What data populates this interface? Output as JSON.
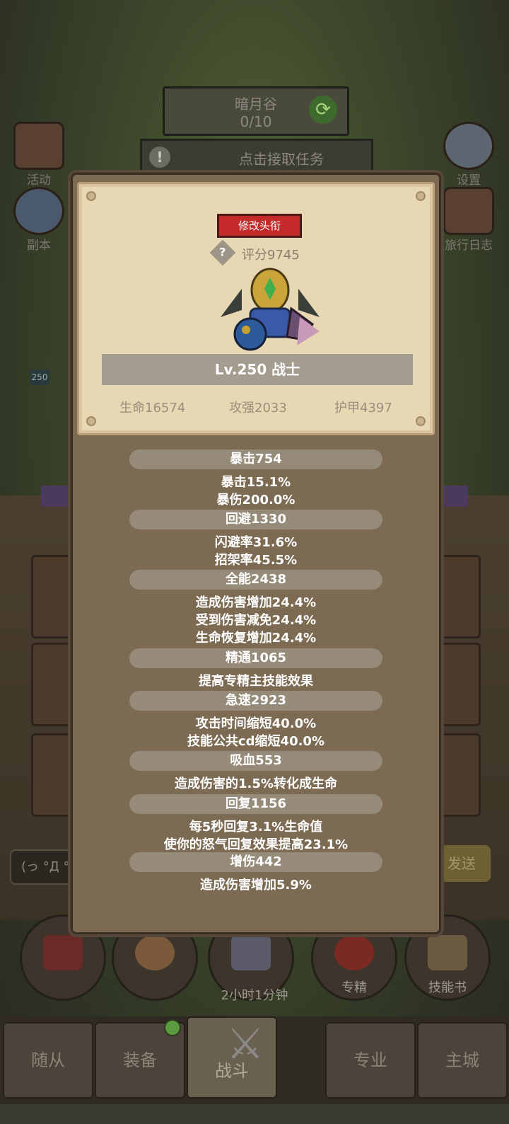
{
  "background": {
    "map_name": "暗月谷",
    "map_progress": "0/10",
    "task_button": "点击接取任务",
    "side_left": [
      "活动",
      "副本"
    ],
    "side_right": [
      "设置",
      "旅行日志"
    ],
    "level_badge": "250",
    "chat_text": "(っ °Д °",
    "send_label": "发送",
    "circle_buttons": [
      "",
      "",
      "",
      "专精",
      "技能书"
    ],
    "timer": "2小时1分钟",
    "nav_tabs": [
      "随从",
      "装备",
      "战斗",
      "专业",
      "主城"
    ]
  },
  "popup": {
    "edit_title_button": "修改头衔",
    "score": "评分9745",
    "level_class": "Lv.250 战士",
    "base_stats": {
      "hp": "生命16574",
      "attack": "攻强2033",
      "armor": "护甲4397"
    },
    "attributes": [
      {
        "title": "暴击754",
        "lines": [
          "暴击15.1%",
          "暴伤200.0%"
        ]
      },
      {
        "title": "回避1330",
        "lines": [
          "闪避率31.6%",
          "招架率45.5%"
        ]
      },
      {
        "title": "全能2438",
        "lines": [
          "造成伤害增加24.4%",
          "受到伤害减免24.4%",
          "生命恢复增加24.4%"
        ]
      },
      {
        "title": "精通1065",
        "lines": [
          "提高专精主技能效果"
        ]
      },
      {
        "title": "急速2923",
        "lines": [
          "攻击时间缩短40.0%",
          "技能公共cd缩短40.0%"
        ]
      },
      {
        "title": "吸血553",
        "lines": [
          "造成伤害的1.5%转化成生命"
        ]
      },
      {
        "title": "回复1156",
        "lines": [
          "每5秒回复3.1%生命值",
          "使你的怒气回复效果提高23.1%"
        ]
      },
      {
        "title": "增伤442",
        "lines": [
          "造成伤害增加5.9%"
        ]
      }
    ]
  }
}
